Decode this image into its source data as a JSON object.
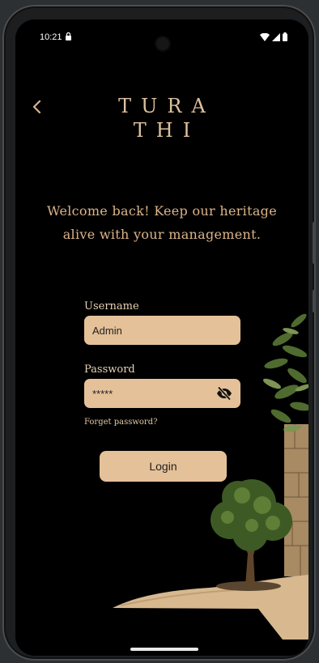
{
  "status_bar": {
    "time": "10:21"
  },
  "brand": {
    "line1": "TURA",
    "line2": "THI"
  },
  "welcome": {
    "line1": "Welcome back! Keep our heritage",
    "line2": "alive with your management."
  },
  "form": {
    "username_label": "Username",
    "username_value": "Admin",
    "password_label": "Password",
    "password_value": "*****",
    "forgot_label": "Forget password?",
    "login_label": "Login"
  },
  "colors": {
    "accent": "#e5c199",
    "text_gold": "#dcb58a",
    "background": "#000000"
  },
  "icons": [
    "back-arrow-icon",
    "lock-icon",
    "wifi-icon",
    "signal-icon",
    "battery-icon",
    "eye-off-icon"
  ]
}
